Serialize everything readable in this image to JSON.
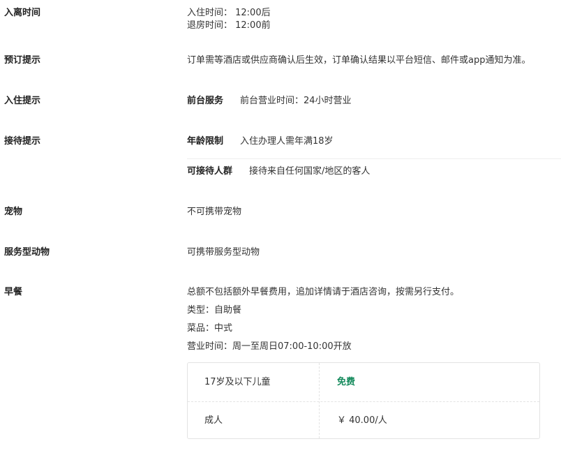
{
  "policies": {
    "checkin_checkout": {
      "label": "入离时间",
      "checkin": "入住时间： 12:00后",
      "checkout": "退房时间： 12:00前"
    },
    "booking_notice": {
      "label": "预订提示",
      "text": "订单需等酒店或供应商确认后生效，订单确认结果以平台短信、邮件或app通知为准。"
    },
    "checkin_notice": {
      "label": "入住提示",
      "front_desk_key": "前台服务",
      "front_desk_value": "前台营业时间：24小时营业"
    },
    "reception_notice": {
      "label": "接待提示",
      "age_key": "年龄限制",
      "age_value": "入住办理人需年满18岁",
      "guests_key": "可接待人群",
      "guests_value": "接待来自任何国家/地区的客人"
    },
    "pets": {
      "label": "宠物",
      "text": "不可携带宠物"
    },
    "service_animals": {
      "label": "服务型动物",
      "text": "可携带服务型动物"
    },
    "breakfast": {
      "label": "早餐",
      "note": "总额不包括额外早餐费用，追加详情请于酒店咨询，按需另行支付。",
      "type": "类型：自助餐",
      "cuisine": "菜品：中式",
      "hours": "营业时间：周一至周日07:00-10:00开放",
      "fees": [
        {
          "who": "17岁及以下儿童",
          "price": "免费"
        },
        {
          "who": "成人",
          "price": "￥ 40.00/人"
        }
      ]
    }
  },
  "colors": {
    "free_price": "#148a5c",
    "divider": "#e3e3e3",
    "text": "#333333"
  }
}
